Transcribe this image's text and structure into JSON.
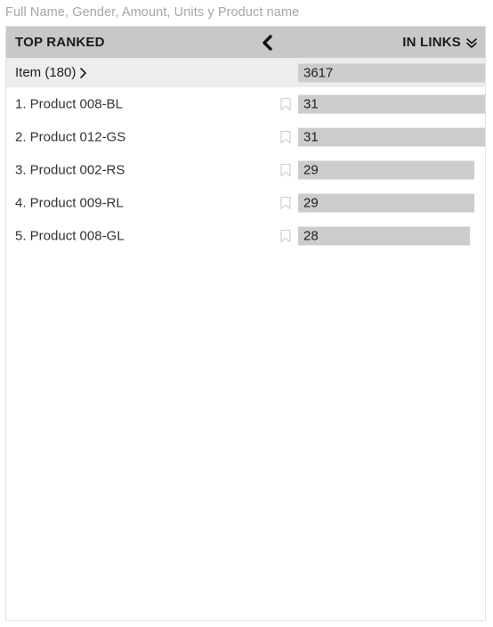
{
  "caption": "Full Name, Gender, Amount, Units y Product name",
  "panel": {
    "titlebar": {
      "title": "TOP RANKED",
      "back_icon": "chevron-left-icon",
      "measure_label": "IN LINKS",
      "measure_icon": "double-chevron-down-icon"
    },
    "total_row": {
      "label": "Item (180)",
      "drill_icon": "chevron-right-icon",
      "value": "3617",
      "bar_pct": 100
    },
    "bookmark_icon": "bookmark-icon",
    "items": [
      {
        "label": "1. Product 008-BL",
        "value": "31",
        "bar_pct": 99
      },
      {
        "label": "2. Product 012-GS",
        "value": "31",
        "bar_pct": 99
      },
      {
        "label": "3. Product 002-RS",
        "value": "29",
        "bar_pct": 93
      },
      {
        "label": "4. Product 009-RL",
        "value": "29",
        "bar_pct": 93
      },
      {
        "label": "5. Product 008-GL",
        "value": "28",
        "bar_pct": 91
      }
    ]
  },
  "chart_data": {
    "type": "bar",
    "title": "TOP RANKED",
    "subtitle": "Full Name, Gender, Amount, Units y Product name",
    "measure": "IN LINKS",
    "dimension": "Item (180)",
    "total": 3617,
    "categories": [
      "1. Product 008-BL",
      "2. Product 012-GS",
      "3. Product 002-RS",
      "4. Product 009-RL",
      "5. Product 008-GL"
    ],
    "values": [
      31,
      31,
      29,
      29,
      28
    ],
    "xlabel": "",
    "ylabel": "",
    "xlim": [
      0,
      31
    ],
    "grid": false,
    "legend": "none",
    "orientation": "horizontal",
    "bar_color": "#cccccc"
  },
  "colors": {
    "titlebar_bg": "#c8c8c8",
    "total_row_bg": "#ededed",
    "bar": "#cccccc",
    "panel_border": "#e3e3e3",
    "caption_text": "#a6a6a6",
    "row_text": "#333333"
  }
}
